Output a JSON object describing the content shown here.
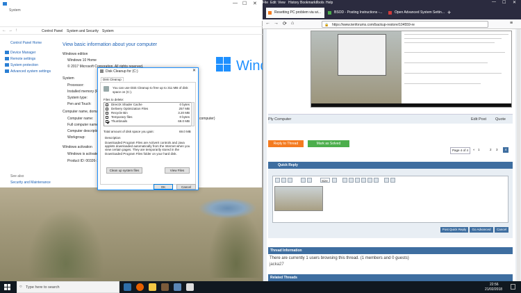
{
  "system_window": {
    "title": "System",
    "address": [
      "Control Panel",
      "System and Security",
      "System"
    ],
    "left_nav": {
      "home": "Control Panel Home",
      "items": [
        "Device Manager",
        "Remote settings",
        "System protection",
        "Advanced system settings"
      ],
      "see_also": "See also",
      "see_also_item": "Security and Maintenance"
    },
    "heading": "View basic information about your computer",
    "windows_edition_label": "Windows edition",
    "edition": "Windows 10 Home",
    "copyright": "© 2017 Microsoft Corporation. All rights reserved.",
    "system_label": "System",
    "rows": [
      "Processor:",
      "Installed memory (RAM):",
      "System type:",
      "Pen and Touch:"
    ],
    "computer_label": "Computer name, domain, and workgroup settings",
    "computer_rows": [
      "Computer name:",
      "Full computer name:",
      "Computer description:",
      "Workgroup:"
    ],
    "activation_label": "Windows activation",
    "activation_row": "Windows is activated",
    "product_id": "Product ID: 00326-1",
    "computer_suffix": "computer)",
    "logo_text": "Windo"
  },
  "disk_cleanup": {
    "title": "Disk Cleanup for  (C:)",
    "tab": "Disk Cleanup",
    "intro": "You can use Disk Cleanup to free up to 311 MB of disk space on  (C:).",
    "files_label": "Files to delete:",
    "files": [
      {
        "name": "DirectX Shader Cache",
        "size": "0 bytes",
        "checked": false
      },
      {
        "name": "Delivery Optimization Files",
        "size": "257 MB",
        "checked": false
      },
      {
        "name": "Recycle Bin",
        "size": "3.20 MB",
        "checked": false
      },
      {
        "name": "Temporary files",
        "size": "0 bytes",
        "checked": false
      },
      {
        "name": "Thumbnails",
        "size": "69.0 MB",
        "checked": true
      }
    ],
    "total_label": "Total amount of disk space you gain:",
    "total_value": "69.0 MB",
    "description_label": "Description",
    "description": "Downloaded Program Files are ActiveX controls and Java applets downloaded automatically from the Internet when you view certain pages. They are temporarily stored in the Downloaded Program Files folder on your hard disk.",
    "cleanup_system": "Clean up system files",
    "view_files": "View Files",
    "ok": "OK",
    "cancel": "Cancel"
  },
  "browser": {
    "menu": [
      "File",
      "Edit",
      "View",
      "History",
      "Bookmarks",
      "Tools",
      "Help"
    ],
    "tabs": [
      "Resetting PC problem via wi...",
      "BSOD - Posting Instructions -...",
      "Open Advanced System Settin..."
    ],
    "url": "https://www.tenforums.com/backup-restore/104559-re",
    "post_footer": {
      "author": "Ply Computer",
      "edit": "Edit Post",
      "quote": "Quote"
    },
    "reply_button": "Reply to Thread",
    "solved_button": "Mark as Solved",
    "pagination": {
      "label": "Page 4 of 4",
      "pages": [
        "1",
        "2",
        "3",
        "4"
      ],
      "prev": "«"
    },
    "quick_reply": "Quick Reply",
    "font_select": "Size",
    "post_quick_reply": "Post Quick Reply",
    "go_advanced": "Go Advanced",
    "cancel": "Cancel",
    "thread_info_title": "Thread Information",
    "thread_info_text": "There are currently 1 users browsing this thread. (1 members and 0 guests)",
    "member": "jacka27",
    "related_threads": "Related Threads"
  },
  "taskbar": {
    "search_placeholder": "Type here to search",
    "time": "22:56",
    "date": "21/02/2018"
  },
  "colors": {
    "accent_blue": "#1e90ff",
    "forum_blue": "#3e6ea0",
    "reply_orange": "#f47b20",
    "solved_green": "#4cae4c"
  }
}
